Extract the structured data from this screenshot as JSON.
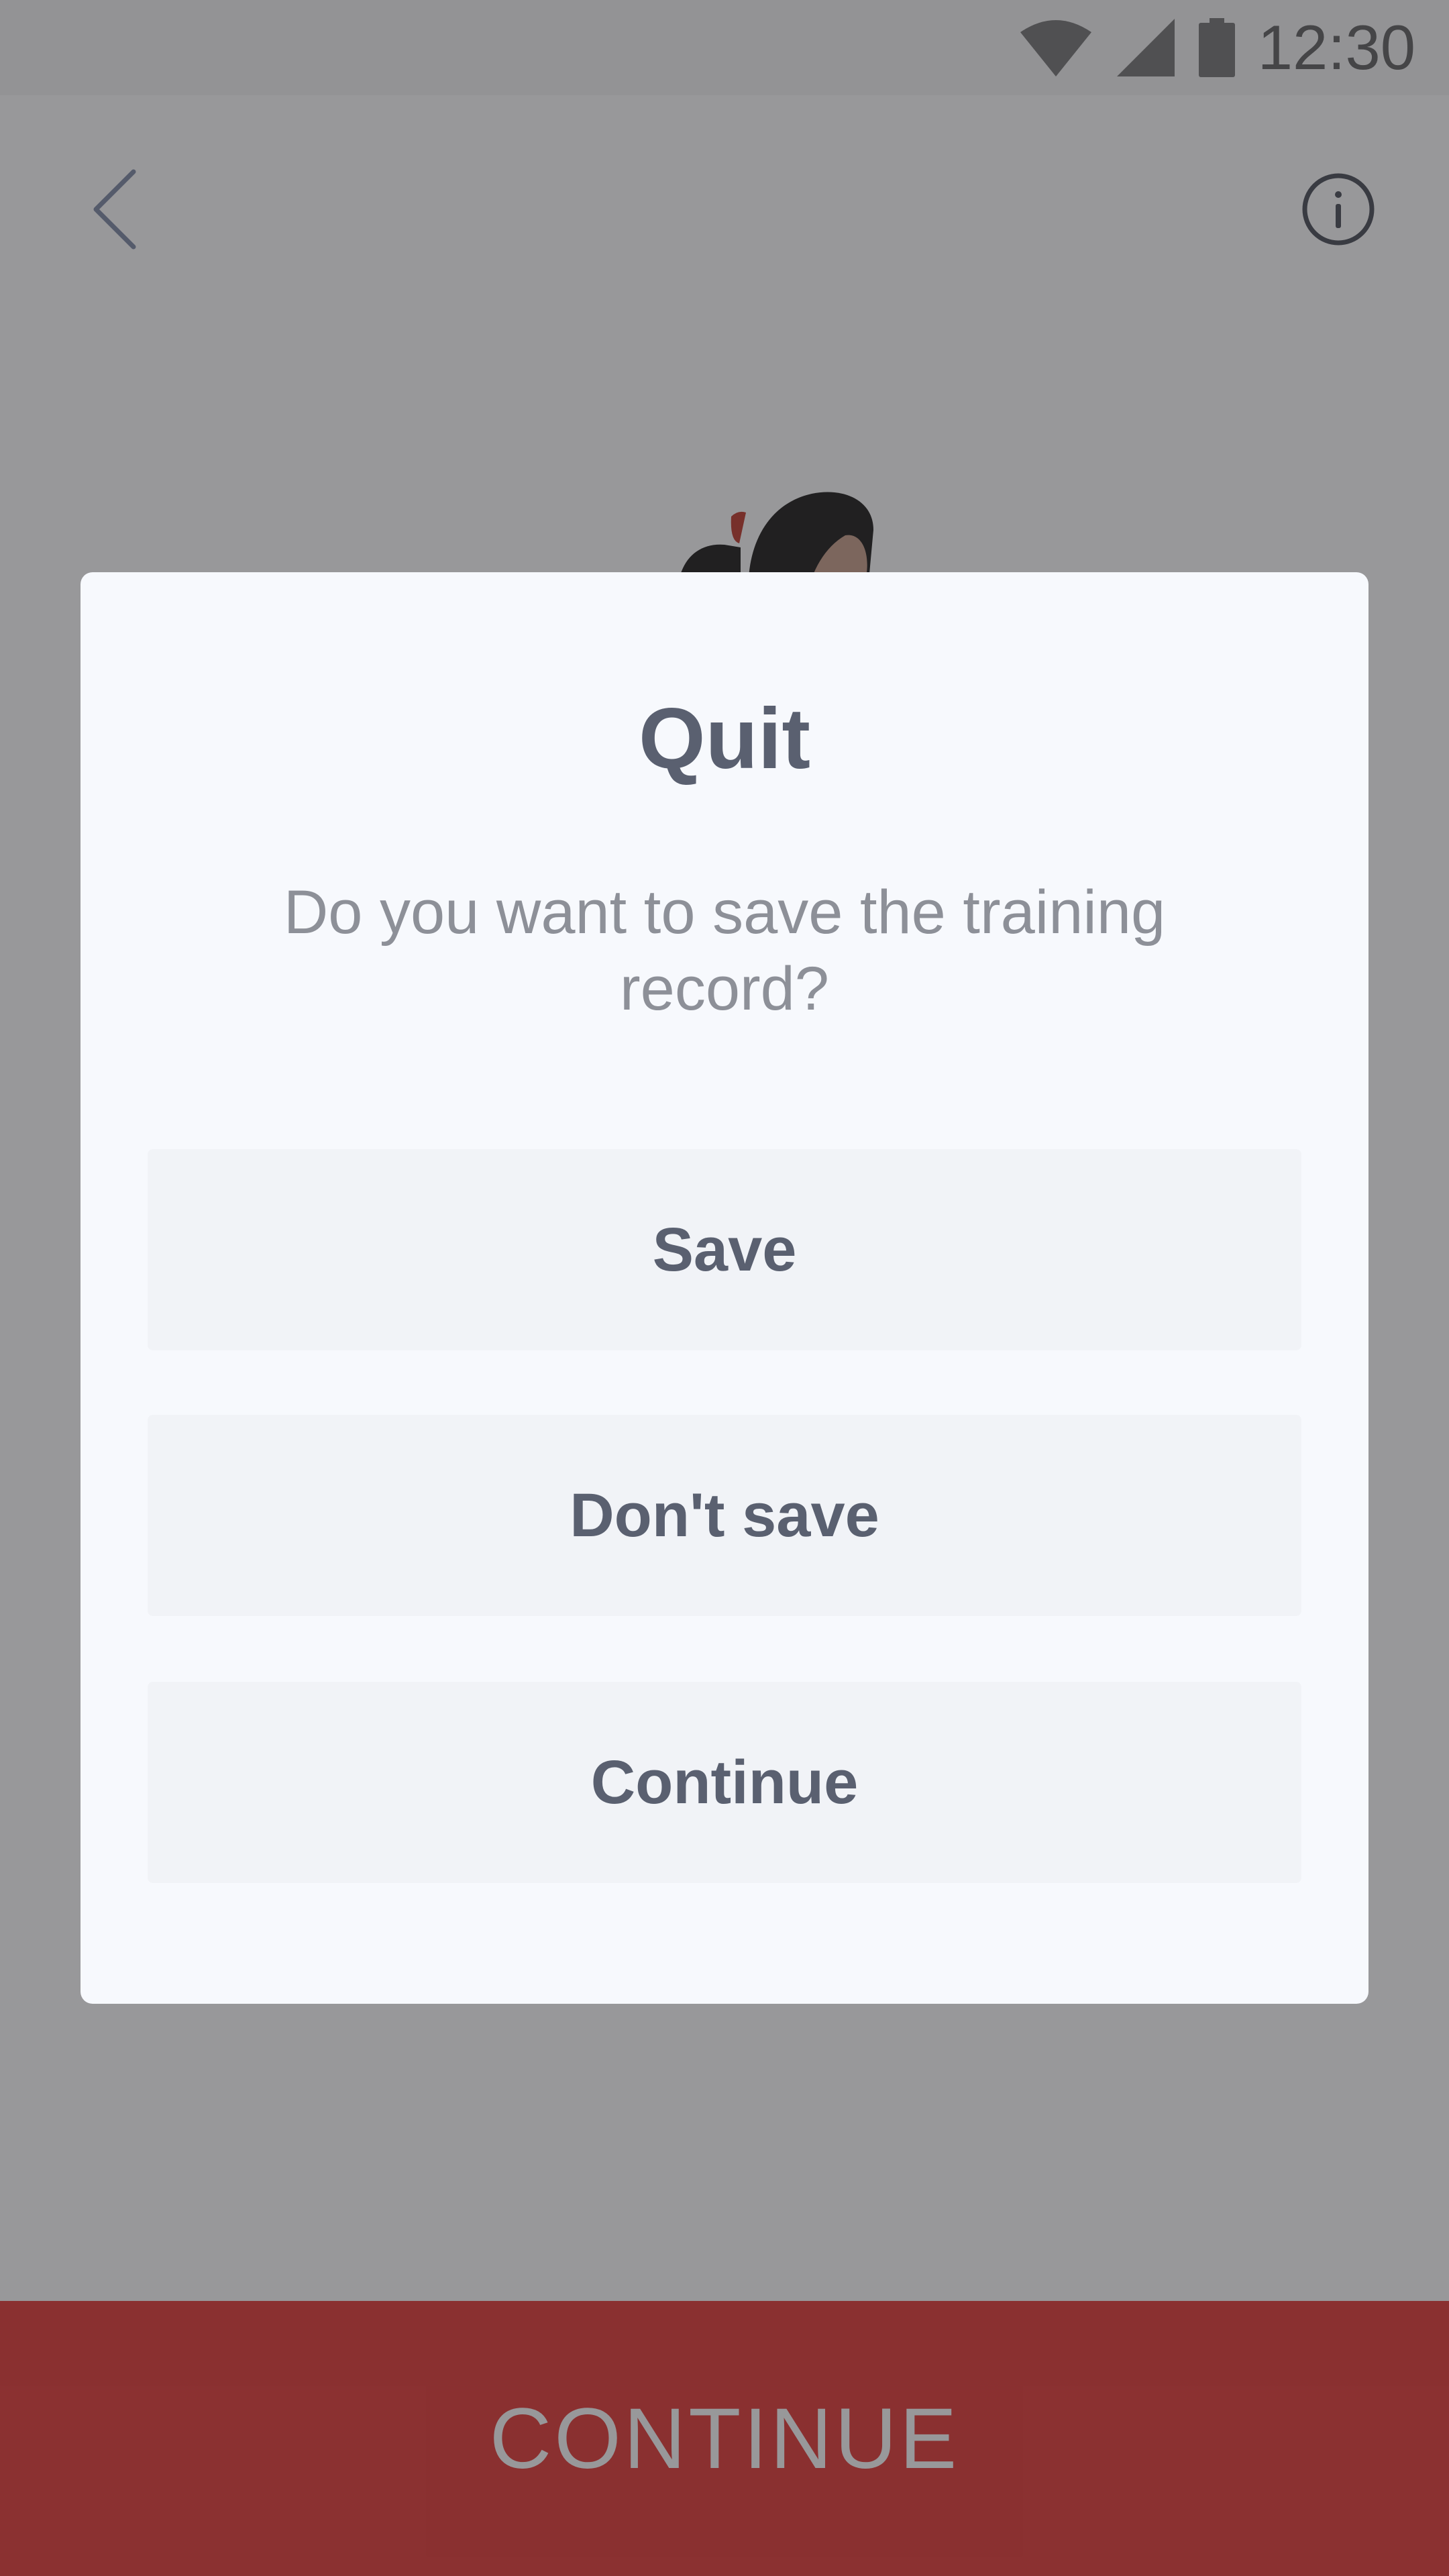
{
  "status_bar": {
    "time": "12:30",
    "icons": [
      "wifi-icon",
      "cellular-signal-icon",
      "battery-icon"
    ]
  },
  "app_bar": {
    "back_icon": "chevron-left-icon",
    "info_icon": "info-circle-icon"
  },
  "dialog": {
    "title": "Quit",
    "message": "Do you want to save the training record?",
    "buttons": {
      "save": "Save",
      "dont_save": "Don't save",
      "continue": "Continue"
    }
  },
  "footer": {
    "continue_label": "CONTINUE"
  },
  "colors": {
    "accent": "#e53935",
    "dialog_background": "#f7f9fd",
    "button_background": "#f1f3f7",
    "text_primary": "#5a6070",
    "text_secondary": "#8d9098"
  }
}
